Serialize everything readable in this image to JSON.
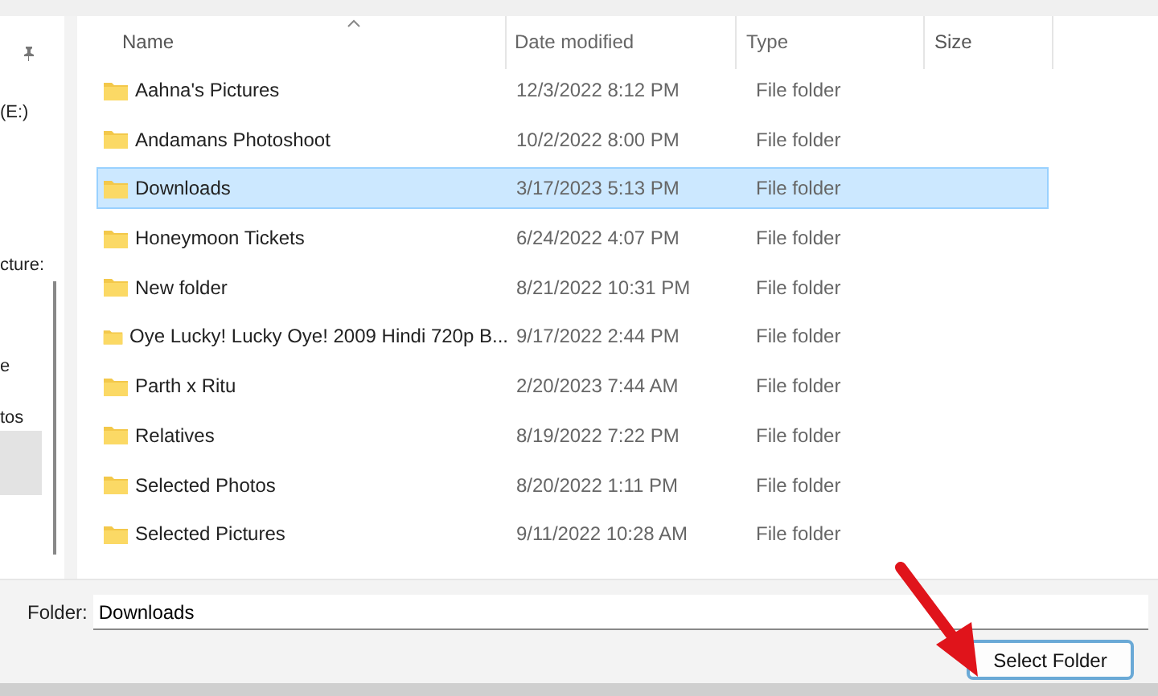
{
  "sidebar": {
    "items": [
      {
        "label": "(E:)",
        "selected": false
      },
      {
        "label": "cture:",
        "selected": false
      },
      {
        "label": "e",
        "selected": false
      },
      {
        "label": "tos",
        "selected": false
      },
      {
        "selected": true
      }
    ]
  },
  "table": {
    "columns": [
      "Name",
      "Date modified",
      "Type",
      "Size"
    ],
    "rows": [
      {
        "name": "Aahna's Pictures",
        "date": "12/3/2022 8:12 PM",
        "type": "File folder",
        "selected": false
      },
      {
        "name": "Andamans Photoshoot",
        "date": "10/2/2022 8:00 PM",
        "type": "File folder",
        "selected": false
      },
      {
        "name": "Downloads",
        "date": "3/17/2023 5:13 PM",
        "type": "File folder",
        "selected": true
      },
      {
        "name": "Honeymoon Tickets",
        "date": "6/24/2022 4:07 PM",
        "type": "File folder",
        "selected": false
      },
      {
        "name": "New folder",
        "date": "8/21/2022 10:31 PM",
        "type": "File folder",
        "selected": false
      },
      {
        "name": "Oye Lucky! Lucky Oye! 2009 Hindi 720p B...",
        "date": "9/17/2022 2:44 PM",
        "type": "File folder",
        "selected": false
      },
      {
        "name": "Parth x Ritu",
        "date": "2/20/2023 7:44 AM",
        "type": "File folder",
        "selected": false
      },
      {
        "name": "Relatives",
        "date": "8/19/2022 7:22 PM",
        "type": "File folder",
        "selected": false
      },
      {
        "name": "Selected Photos",
        "date": "8/20/2022 1:11 PM",
        "type": "File folder",
        "selected": false
      },
      {
        "name": "Selected Pictures",
        "date": "9/11/2022 10:28 AM",
        "type": "File folder",
        "selected": false
      }
    ]
  },
  "folder_field": {
    "label": "Folder:",
    "value": "Downloads"
  },
  "buttons": [
    {
      "label": "Select Folder"
    }
  ]
}
